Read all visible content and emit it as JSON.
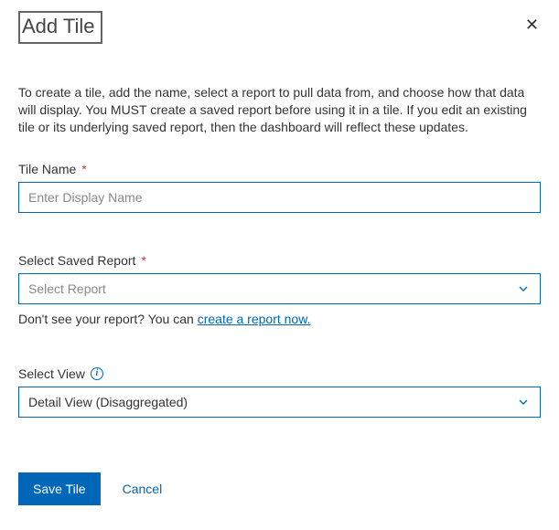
{
  "header": {
    "title": "Add Tile",
    "close_glyph": "✕"
  },
  "description": "To create a tile, add the name, select a report to pull data from, and choose how that data will display. You MUST create a saved report before using it in a tile. If you edit an existing tile or its underlying saved report, then the dashboard will reflect these updates.",
  "fields": {
    "tile_name": {
      "label": "Tile Name",
      "placeholder": "Enter Display Name",
      "value": ""
    },
    "saved_report": {
      "label": "Select Saved Report",
      "placeholder": "Select Report",
      "hint_prefix": "Don't see your report? You can ",
      "hint_link": "create a report now."
    },
    "view": {
      "label": "Select View",
      "value": "Detail View (Disaggregated)"
    }
  },
  "footer": {
    "save": "Save Tile",
    "cancel": "Cancel"
  }
}
